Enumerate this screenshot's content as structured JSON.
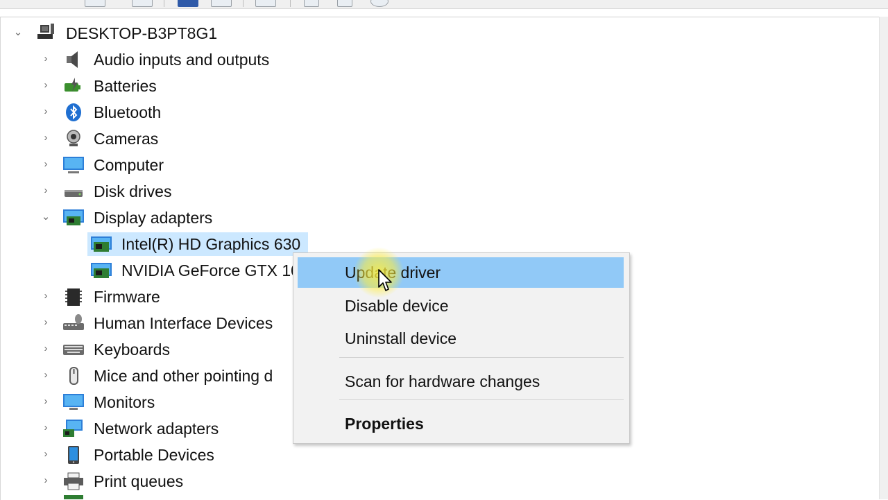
{
  "computer_name": "DESKTOP-B3PT8G1",
  "categories_top": [
    {
      "label": "Audio inputs and outputs",
      "icon": "speaker-icon"
    },
    {
      "label": "Batteries",
      "icon": "battery-icon"
    },
    {
      "label": "Bluetooth",
      "icon": "bluetooth-icon"
    },
    {
      "label": "Cameras",
      "icon": "camera-icon"
    },
    {
      "label": "Computer",
      "icon": "computer-icon"
    },
    {
      "label": "Disk drives",
      "icon": "disk-drive-icon"
    }
  ],
  "display_adapters": {
    "label": "Display adapters",
    "icon": "display-adapter-icon",
    "children": [
      {
        "label": "Intel(R) HD Graphics 630",
        "icon": "graphics-card-icon",
        "selected": true
      },
      {
        "label": "NVIDIA GeForce GTX 10",
        "icon": "graphics-card-icon",
        "selected": false
      }
    ]
  },
  "categories_bottom": [
    {
      "label": "Firmware",
      "icon": "firmware-chip-icon"
    },
    {
      "label": "Human Interface Devices",
      "icon": "hid-icon"
    },
    {
      "label": "Keyboards",
      "icon": "keyboard-icon"
    },
    {
      "label": "Mice and other pointing d",
      "icon": "mouse-icon"
    },
    {
      "label": "Monitors",
      "icon": "monitor-icon"
    },
    {
      "label": "Network adapters",
      "icon": "network-adapter-icon"
    },
    {
      "label": "Portable Devices",
      "icon": "portable-device-icon"
    },
    {
      "label": "Print queues",
      "icon": "printer-icon"
    }
  ],
  "context_menu": {
    "items": [
      "Update driver",
      "Disable device",
      "Uninstall device",
      "Scan for hardware changes",
      "Properties"
    ],
    "hovered": "Update driver"
  },
  "colors": {
    "selection": "#cce8ff",
    "menu_hover": "#91c9f7",
    "menu_background": "#f2f2f2"
  }
}
